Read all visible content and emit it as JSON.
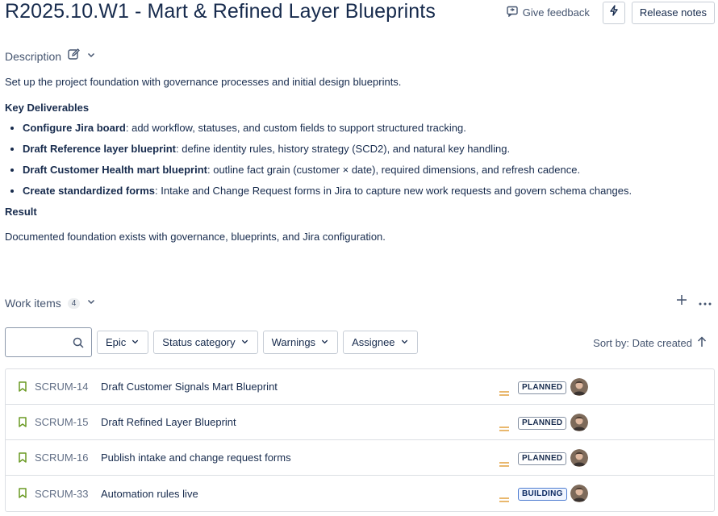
{
  "header": {
    "title": "R2025.10.W1 - Mart & Refined Layer Blueprints",
    "feedback_label": "Give feedback",
    "release_notes_label": "Release notes"
  },
  "description": {
    "label": "Description",
    "intro": "Set up the project foundation with governance processes and initial design blueprints.",
    "deliverables_heading": "Key Deliverables",
    "items": [
      {
        "bold": "Configure Jira board",
        "text": ": add workflow, statuses, and custom fields to support structured tracking."
      },
      {
        "bold": "Draft Reference layer blueprint",
        "text": ": define identity rules, history strategy (SCD2), and natural key handling."
      },
      {
        "bold": "Draft Customer Health mart blueprint",
        "text": ": outline fact grain (customer × date), required dimensions, and refresh cadence."
      },
      {
        "bold": "Create standardized forms",
        "text": ": Intake and Change Request forms in Jira to capture new work requests and govern schema changes."
      }
    ],
    "result_heading": "Result",
    "result_text": "Documented foundation exists with governance, blueprints, and Jira configuration."
  },
  "work_items": {
    "label": "Work items",
    "count": "4",
    "search": {
      "value": "",
      "placeholder": ""
    },
    "filters": [
      "Epic",
      "Status category",
      "Warnings",
      "Assignee"
    ],
    "sort_label": "Sort by: Date created",
    "rows": [
      {
        "key": "SCRUM-14",
        "summary": "Draft Customer Signals Mart Blueprint",
        "status": "PLANNED"
      },
      {
        "key": "SCRUM-15",
        "summary": "Draft Refined Layer Blueprint",
        "status": "PLANNED"
      },
      {
        "key": "SCRUM-16",
        "summary": "Publish intake and change request forms",
        "status": "PLANNED"
      },
      {
        "key": "SCRUM-33",
        "summary": "Automation rules live",
        "status": "BUILDING"
      }
    ]
  },
  "colors": {
    "bookmark": "#6a9a23",
    "priority": "#e2a03f",
    "building_border": "#4c7bd0"
  }
}
